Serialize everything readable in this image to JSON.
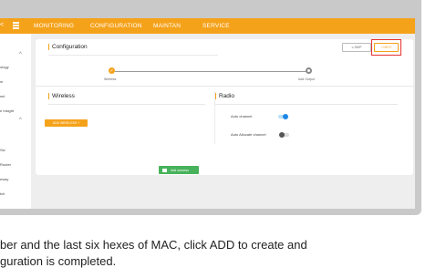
{
  "topbar": {
    "sidebar_close": "<",
    "nav": [
      "MONITORING",
      "CONFIGURATION",
      "MAINTAN",
      "SERVICE"
    ]
  },
  "sidebar": {
    "items": [
      "ology",
      "m",
      "nel",
      "e Insight",
      "Ssi",
      "Router",
      "eway",
      "tch"
    ],
    "caret": "^"
  },
  "card": {
    "title": "Configuration",
    "skip_label": "≤ SKIP",
    "next_label": "> NEXT",
    "steps": [
      "Wireless",
      "Add Output"
    ],
    "step_done_mark": "✓"
  },
  "wireless": {
    "title": "Wireless",
    "add_label": "ADD WIRELESS +"
  },
  "radio": {
    "title": "Radio",
    "auto_channel_label": "Auto channel",
    "auto_channel_on": true,
    "auto_allocate_label": "Auto Allocate channel",
    "auto_allocate_on": false
  },
  "footer": {
    "add_success_label": "Add success"
  },
  "caption": {
    "line1": "ber and the last six hexes of MAC, click ADD to create and",
    "line2": "guration is completed."
  },
  "colors": {
    "accent": "#f5a21b",
    "success": "#47b25a",
    "toggle_on": "#1e88e5",
    "highlight": "#e5322f"
  }
}
